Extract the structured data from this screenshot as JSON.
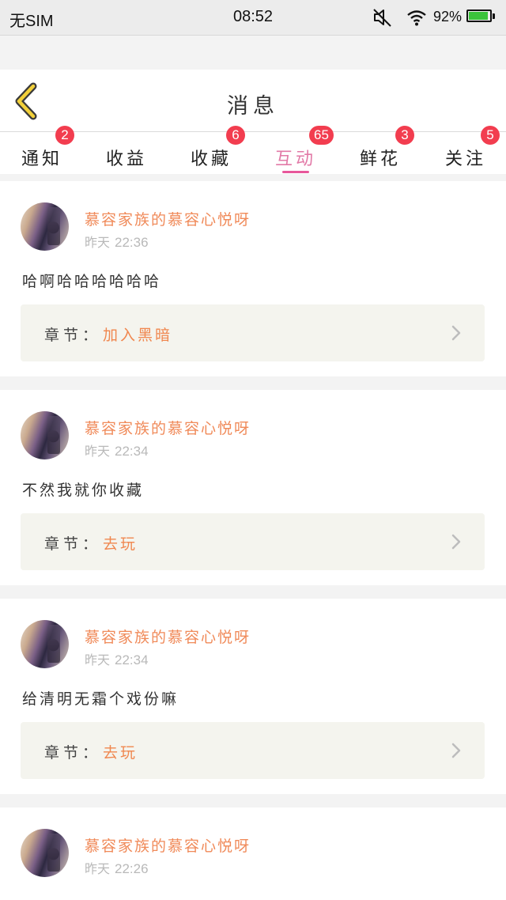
{
  "status_bar": {
    "carrier": "无SIM",
    "time": "08:52",
    "battery": "92%",
    "battery_level": 0.92,
    "icons": [
      "mute-icon",
      "wifi-icon",
      "battery-icon"
    ]
  },
  "header": {
    "title": "消息",
    "back_icon": "chevron-left-icon"
  },
  "tabs": [
    {
      "label": "通知",
      "badge": "2"
    },
    {
      "label": "收益",
      "badge": ""
    },
    {
      "label": "收藏",
      "badge": "6"
    },
    {
      "label": "互动",
      "badge": "65",
      "active": true
    },
    {
      "label": "鲜花",
      "badge": "3"
    },
    {
      "label": "关注",
      "badge": "5"
    }
  ],
  "messages": [
    {
      "user": "慕容家族的慕容心悦呀",
      "day": "昨天",
      "time": "22:36",
      "comment": "哈啊哈哈哈哈哈哈",
      "chapter_label": "章节：",
      "chapter": "加入黑暗"
    },
    {
      "user": "慕容家族的慕容心悦呀",
      "day": "昨天",
      "time": "22:34",
      "comment": "不然我就你收藏",
      "chapter_label": "章节：",
      "chapter": "去玩"
    },
    {
      "user": "慕容家族的慕容心悦呀",
      "day": "昨天",
      "time": "22:34",
      "comment": "给清明无霜个戏份嘛",
      "chapter_label": "章节：",
      "chapter": "去玩"
    },
    {
      "user": "慕容家族的慕容心悦呀",
      "day": "昨天",
      "time": "22:26",
      "comment": "",
      "chapter_label": "",
      "chapter": ""
    }
  ],
  "colors": {
    "accent_pink": "#e8579a",
    "username_orange": "#f08a59",
    "badge_red": "#f23d4f",
    "battery_green": "#3bc43b"
  }
}
